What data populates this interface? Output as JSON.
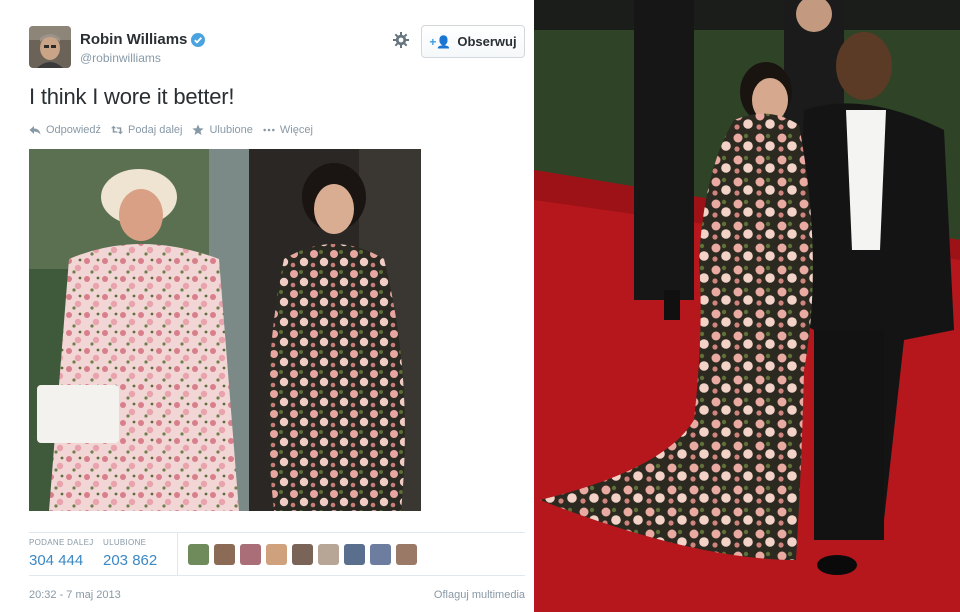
{
  "tweet": {
    "author_name": "Robin Williams",
    "handle": "@robinwilliams",
    "follow_label": "Obserwuj",
    "text": "I think I wore it better!",
    "actions": {
      "reply": "Odpowiedź",
      "retweet": "Podaj dalej",
      "favorite": "Ulubione",
      "more": "Więcej"
    },
    "stats": {
      "retweets_label": "PODANE DALEJ",
      "retweets_value": "304 444",
      "favorites_label": "ULUBIONE",
      "favorites_value": "203 862"
    },
    "timestamp": "20:32 - 7 maj 2013",
    "flag_media": "Oflaguj multimedia",
    "faver_count": 9
  },
  "icons": {
    "avatar": "avatar-photo",
    "verified": "verified-badge-icon",
    "gear": "gear-icon",
    "follow": "follow-user-icon",
    "reply": "reply-icon",
    "retweet": "retweet-icon",
    "favorite": "star-icon",
    "more": "more-dots-icon"
  },
  "colors": {
    "accent_blue": "#3b88c3",
    "muted_gray": "#8899a6",
    "text_dark": "#292f33",
    "red_carpet": "#b5171c",
    "floral_pink": "#e8a7a7"
  }
}
